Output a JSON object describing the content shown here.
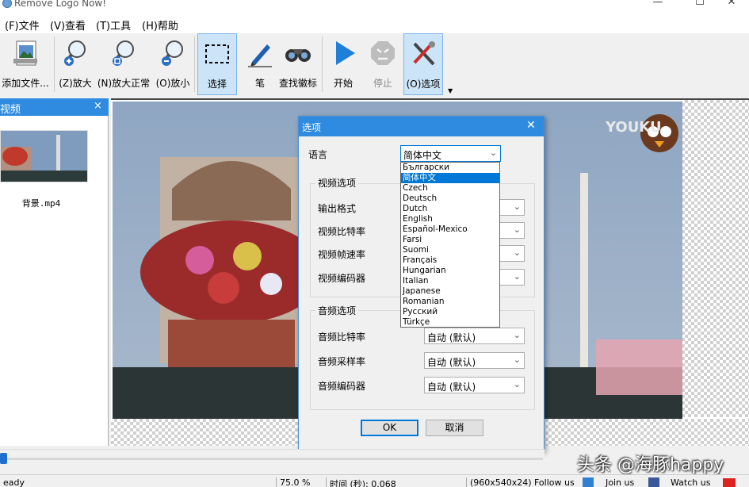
{
  "window": {
    "title": "Remove Logo Now!",
    "minimize": "—",
    "maximize": "☐",
    "close": "✕"
  },
  "menu": [
    "(F)文件",
    "(V)查看",
    "(T)工具",
    "(H)帮助"
  ],
  "toolbar": {
    "add": "添加文件...",
    "zoom_in": "(Z)放大",
    "zoom_normal": "(N)放大正常",
    "zoom_out": "(O)放小",
    "select": "选择",
    "pen": "笔",
    "find_logo": "查找徽标",
    "start": "开始",
    "stop": "停止",
    "options": "(O)选项"
  },
  "panel": {
    "title": "视频",
    "close": "×",
    "file_name": "背景.mp4"
  },
  "video": {
    "logo_text": "YOUKU"
  },
  "dialog": {
    "title": "选项",
    "close": "✕",
    "language_label": "语言",
    "language_value": "简体中文",
    "video_group": "视频选项",
    "video_rows": [
      "输出格式",
      "视频比特率",
      "视频帧速率",
      "视频编码器"
    ],
    "audio_group": "音频选项",
    "audio_rows": [
      {
        "label": "音频比特率",
        "value": "自动 (默认)"
      },
      {
        "label": "音频采样率",
        "value": "自动 (默认)"
      },
      {
        "label": "音频编码器",
        "value": "自动 (默认)"
      }
    ],
    "ok": "OK",
    "cancel": "取消"
  },
  "language_options": [
    "Български",
    "简体中文",
    "Czech",
    "Deutsch",
    "Dutch",
    "English",
    "Español-Mexico",
    "Farsi",
    "Suomi",
    "Français",
    "Hungarian",
    "Italian",
    "Japanese",
    "Romanian",
    "Русский",
    "Türkçe"
  ],
  "language_selected_index": 1,
  "progress": {
    "fraction": 0.013
  },
  "statusbar": {
    "ready": "eady",
    "zoom": "75.0 %",
    "time": "时间 (秒): 0.068",
    "size": "(960x540x24)",
    "follow": "Follow us",
    "join": "Join us",
    "watch": "Watch us"
  },
  "watermark": "头条 @海豚happy",
  "colors": {
    "accent": "#2f8be0",
    "selection": "#0078d7",
    "play": "#1e7fd6"
  }
}
